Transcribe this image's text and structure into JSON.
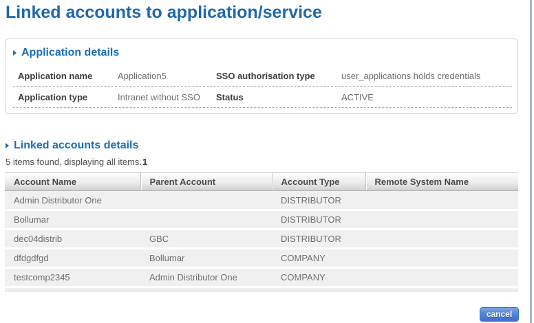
{
  "page": {
    "title": "Linked accounts to application/service"
  },
  "colors": {
    "heading_blue": "#1e68ad",
    "section_blue": "#1b6fb5",
    "row_background": "#f0f0f0",
    "right_border": "#a3bcca",
    "button_blue": "#4273cd"
  },
  "application_details": {
    "title": "Application details",
    "fields": [
      {
        "label": "Application name",
        "value": "Application5"
      },
      {
        "label": "SSO authorisation type",
        "value": "user_applications holds credentials"
      },
      {
        "label": "Application type",
        "value": "Intranet without SSO"
      },
      {
        "label": "Status",
        "value": "ACTIVE"
      }
    ]
  },
  "linked_accounts": {
    "title": "Linked accounts details",
    "summary": "5 items found, displaying all items.",
    "page_number": "1",
    "table": {
      "columns": [
        "Account Name",
        "Parent Account",
        "Account Type",
        "Remote System Name"
      ],
      "rows": [
        {
          "account_name": "Admin Distributor One",
          "parent_account": "",
          "account_type": "DISTRIBUTOR",
          "remote_system_name": ""
        },
        {
          "account_name": "Bollumar",
          "parent_account": "",
          "account_type": "DISTRIBUTOR",
          "remote_system_name": ""
        },
        {
          "account_name": "dec04distrib",
          "parent_account": "GBC",
          "account_type": "DISTRIBUTOR",
          "remote_system_name": ""
        },
        {
          "account_name": "dfdgdfgd",
          "parent_account": "Bollumar",
          "account_type": "COMPANY",
          "remote_system_name": ""
        },
        {
          "account_name": "testcomp2345",
          "parent_account": "Admin Distributor One",
          "account_type": "COMPANY",
          "remote_system_name": ""
        }
      ]
    }
  },
  "actions": {
    "cancel_label": "cancel"
  }
}
